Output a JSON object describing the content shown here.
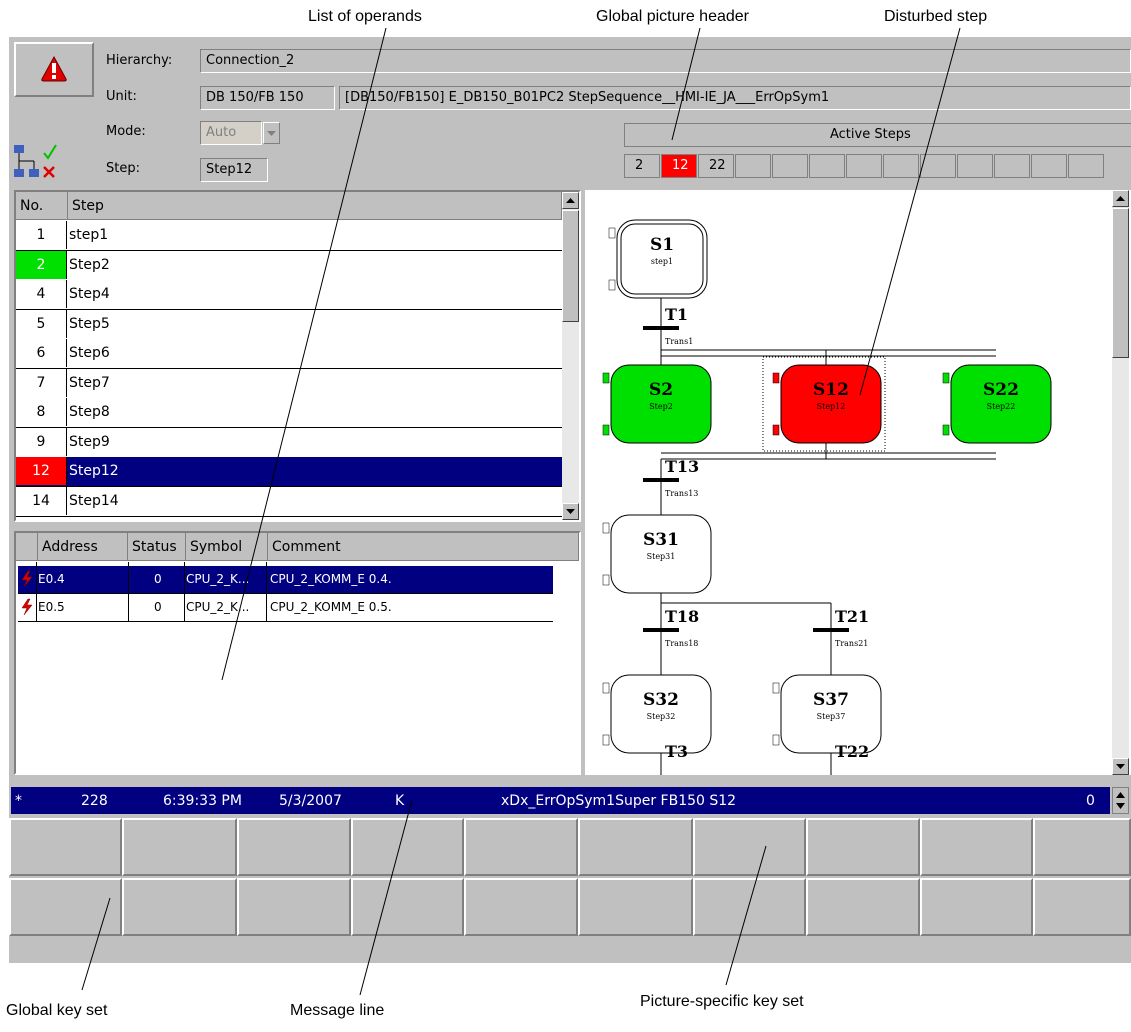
{
  "callouts": {
    "operands": "List of operands",
    "global_header": "Global picture header",
    "disturbed_step": "Disturbed step",
    "global_keys": "Global key set",
    "message_line": "Message line",
    "picture_keys": "Picture-specific key set"
  },
  "header": {
    "hierarchy_label": "Hierarchy:",
    "hierarchy_value": "Connection_2",
    "unit_label": "Unit:",
    "unit_value": "DB 150/FB 150",
    "unit_detail": "[DB150/FB150] E_DB150_B01PC2 StepSequence__HMI-IE_JA___ErrOpSym1",
    "mode_label": "Mode:",
    "mode_value": "Auto",
    "step_label": "Step:",
    "step_value": "Step12",
    "active_steps_label": "Active Steps",
    "active_steps": [
      "2",
      "12",
      "22",
      "",
      "",
      "",
      "",
      "",
      "",
      "",
      "",
      "",
      ""
    ]
  },
  "steps_table": {
    "col_no": "No.",
    "col_step": "Step",
    "rows": [
      {
        "no": "1",
        "name": "step1",
        "state": "normal"
      },
      {
        "no": "2",
        "name": "Step2",
        "state": "active"
      },
      {
        "no": "4",
        "name": "Step4",
        "state": "normal"
      },
      {
        "no": "5",
        "name": "Step5",
        "state": "normal"
      },
      {
        "no": "6",
        "name": "Step6",
        "state": "normal"
      },
      {
        "no": "7",
        "name": "Step7",
        "state": "normal"
      },
      {
        "no": "8",
        "name": "Step8",
        "state": "normal"
      },
      {
        "no": "9",
        "name": "Step9",
        "state": "normal"
      },
      {
        "no": "12",
        "name": "Step12",
        "state": "error-selected"
      },
      {
        "no": "14",
        "name": "Step14",
        "state": "normal"
      }
    ]
  },
  "operands_table": {
    "col_address": "Address",
    "col_status": "Status",
    "col_symbol": "Symbol",
    "col_comment": "Comment",
    "rows": [
      {
        "address": "E0.4",
        "status": "0",
        "symbol": "CPU_2_K...",
        "comment": "CPU_2_KOMM_E 0.4.",
        "selected": true
      },
      {
        "address": "E0.5",
        "status": "0",
        "symbol": "CPU_2_K...",
        "comment": "CPU_2_KOMM_E 0.5.",
        "selected": false
      }
    ]
  },
  "graph": {
    "steps": [
      {
        "id": "S1",
        "sub": "step1",
        "state": "initial"
      },
      {
        "id": "S2",
        "sub": "Step2",
        "state": "active"
      },
      {
        "id": "S12",
        "sub": "Step12",
        "state": "error"
      },
      {
        "id": "S22",
        "sub": "Step22",
        "state": "active"
      },
      {
        "id": "S31",
        "sub": "Step31",
        "state": "normal"
      },
      {
        "id": "S32",
        "sub": "Step32",
        "state": "normal"
      },
      {
        "id": "S37",
        "sub": "Step37",
        "state": "normal"
      }
    ],
    "transitions": [
      {
        "id": "T1",
        "sub": "Trans1"
      },
      {
        "id": "T13",
        "sub": "Trans13"
      },
      {
        "id": "T18",
        "sub": "Trans18"
      },
      {
        "id": "T21",
        "sub": "Trans21"
      },
      {
        "id": "T3",
        "sub": ""
      },
      {
        "id": "T22",
        "sub": ""
      }
    ]
  },
  "message_line": {
    "marker": "*",
    "number": "228",
    "time": "6:39:33 PM",
    "date": "5/3/2007",
    "status": "K",
    "text": "xDx_ErrOpSym1Super FB150 S12",
    "count": "0"
  },
  "colors": {
    "panel": "#c0c0c0",
    "active_green": "#00e000",
    "error_red": "#ff0000",
    "selection_navy": "#000080"
  },
  "icons": {
    "alarm": "alarm-triangle-icon",
    "mode": "network-check-icon",
    "operand": "lightning-operand-icon"
  }
}
